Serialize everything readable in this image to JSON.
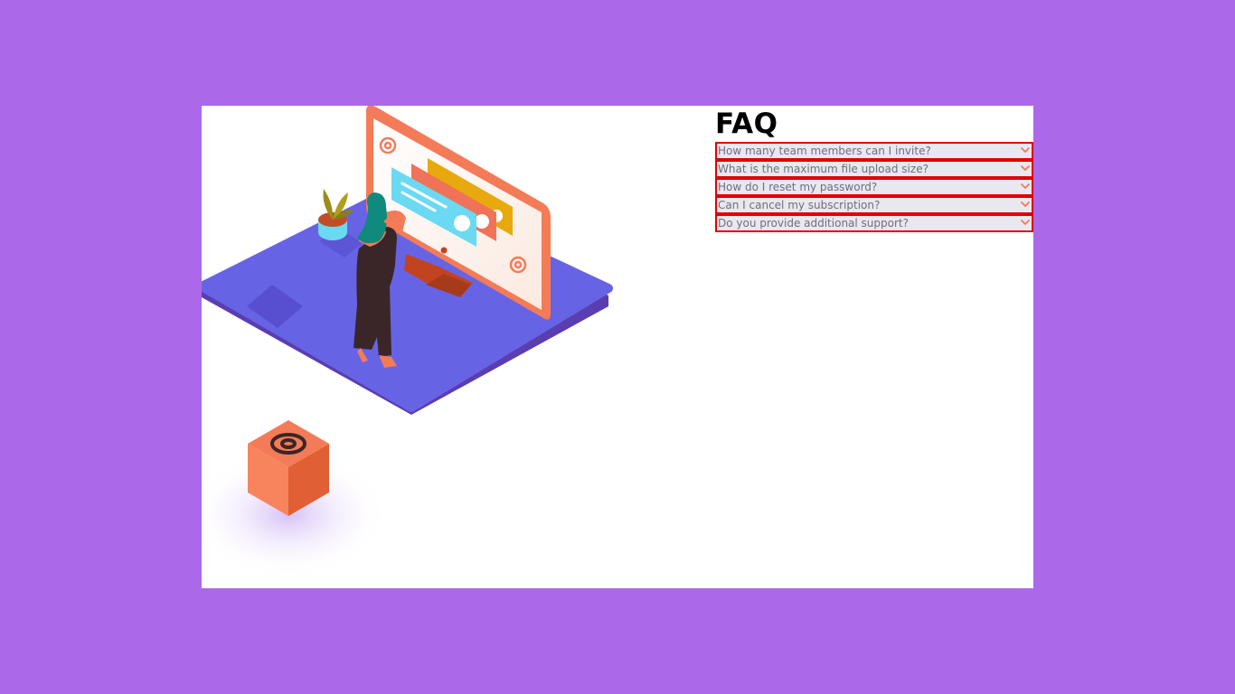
{
  "colors": {
    "page_background": "#ab68e8",
    "card_background": "#ffffff",
    "item_border": "#e00000",
    "item_background": "#e9e8ee",
    "question_text": "#6e6e7e",
    "chevron": "#f0785a"
  },
  "faq": {
    "title": "FAQ",
    "items": [
      {
        "question": "How many team members can I invite?",
        "icon": "chevron-down-icon"
      },
      {
        "question": "What is the maximum file upload size?",
        "icon": "chevron-down-icon"
      },
      {
        "question": "How do I reset my password?",
        "icon": "chevron-down-icon"
      },
      {
        "question": "Can I cancel my subscription?",
        "icon": "chevron-down-icon"
      },
      {
        "question": "Do you provide additional support?",
        "icon": "chevron-down-icon"
      }
    ]
  },
  "illustration": {
    "icons": [
      "woman-online-illustration",
      "desktop-monitor-icon",
      "at-sign-icon",
      "plant-pot-icon",
      "box-icon"
    ]
  }
}
